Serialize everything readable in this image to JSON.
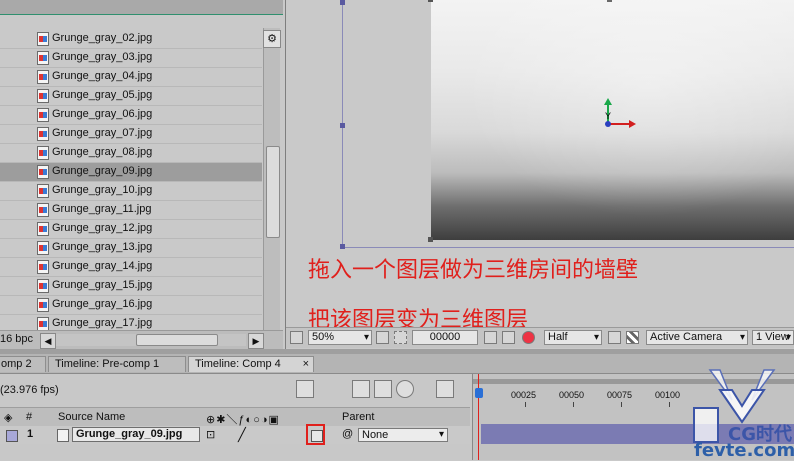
{
  "project": {
    "files": [
      "Grunge_gray_02.jpg",
      "Grunge_gray_03.jpg",
      "Grunge_gray_04.jpg",
      "Grunge_gray_05.jpg",
      "Grunge_gray_06.jpg",
      "Grunge_gray_07.jpg",
      "Grunge_gray_08.jpg",
      "Grunge_gray_09.jpg",
      "Grunge_gray_10.jpg",
      "Grunge_gray_11.jpg",
      "Grunge_gray_12.jpg",
      "Grunge_gray_13.jpg",
      "Grunge_gray_14.jpg",
      "Grunge_gray_15.jpg",
      "Grunge_gray_16.jpg",
      "Grunge_gray_17.jpg"
    ],
    "selected_file": "Grunge_gray_09.jpg",
    "bpc": "16 bpc"
  },
  "viewer": {
    "caption1": "拖入一个图层做为三维房间的墙壁",
    "caption2": "把该图层变为三维图层",
    "gizmo_axis_label": "Y"
  },
  "viewer_toolbar": {
    "zoom": "50%",
    "timecode": "00000",
    "resolution": "Half",
    "camera": "Active Camera",
    "view": "1 View"
  },
  "timeline": {
    "tabs": [
      {
        "label": "omp 2"
      },
      {
        "label": "Timeline: Pre-comp 1"
      },
      {
        "label": "Timeline: Comp 4",
        "active": true
      }
    ],
    "fps": "(23.976 fps)",
    "columns": {
      "number": "#",
      "source": "Source Name",
      "parent": "Parent"
    },
    "layer": {
      "index": "1",
      "name": "Grunge_gray_09.jpg",
      "parent": "None"
    },
    "ruler_ticks": [
      "00025",
      "00050",
      "00075",
      "00100"
    ]
  },
  "watermark": {
    "text": "fevte.com"
  },
  "colors": {
    "annotation": "#e0201c",
    "layer_bar": "#7b7bb3",
    "playhead": "#e0201c"
  }
}
